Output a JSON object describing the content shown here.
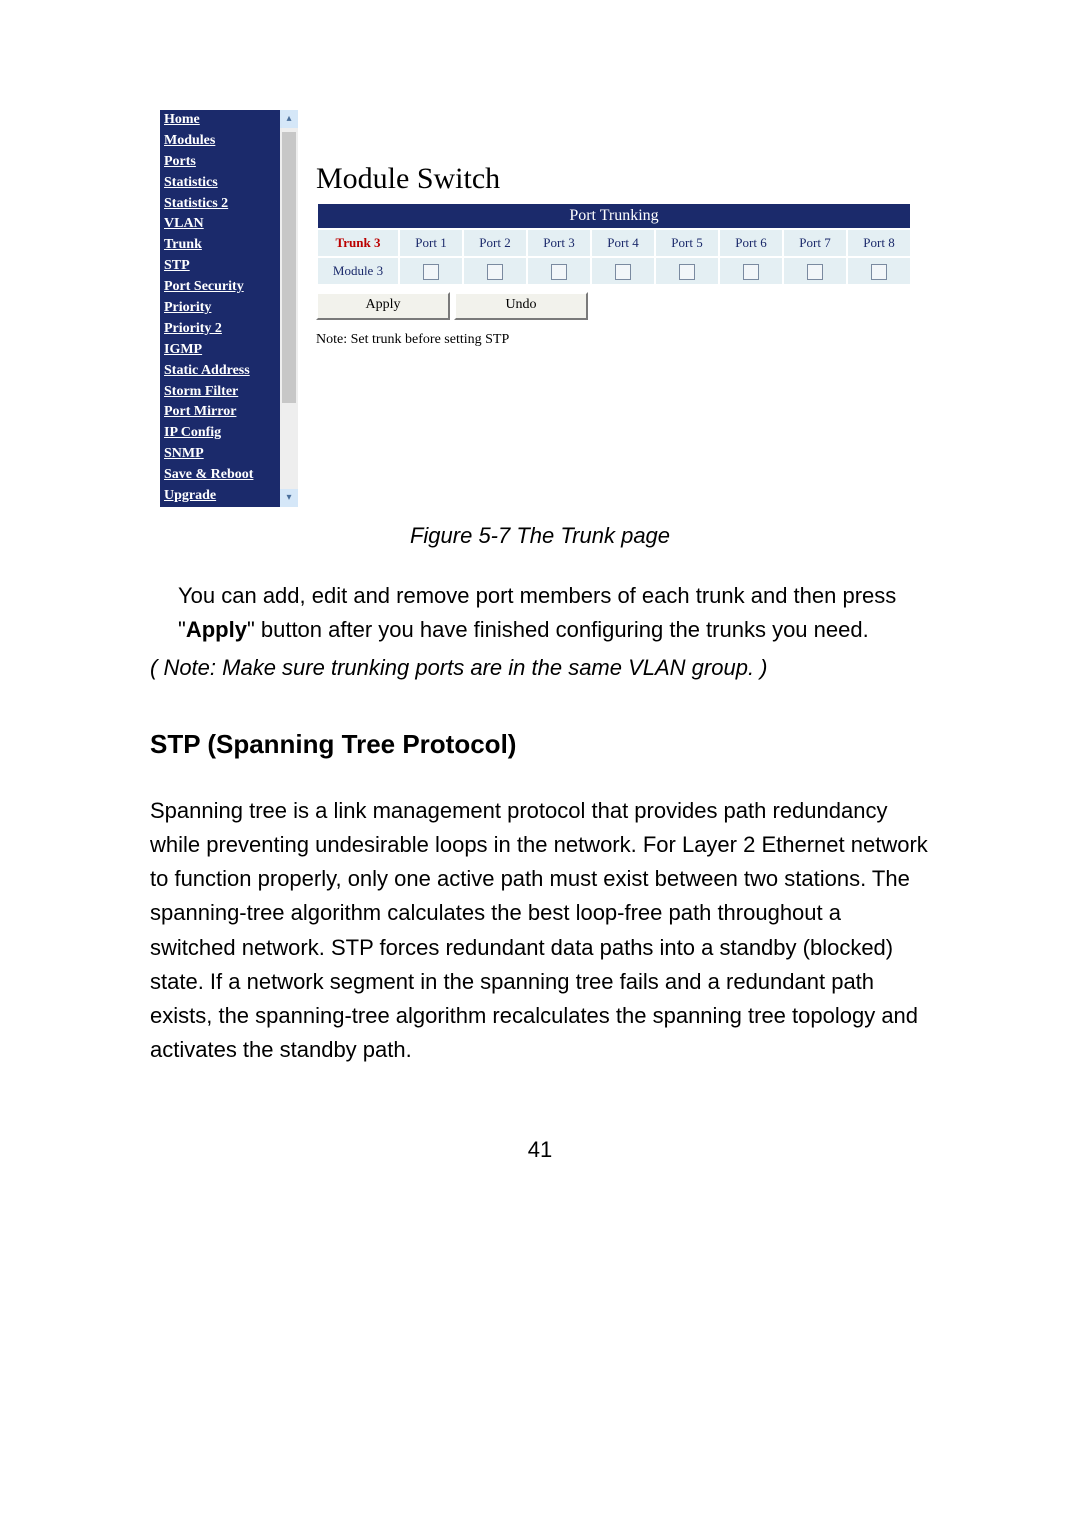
{
  "sidebar": {
    "items": [
      "Home",
      "Modules",
      "Ports",
      "Statistics",
      "Statistics 2",
      "VLAN",
      "Trunk",
      "STP",
      "Port Security",
      "Priority",
      "Priority 2",
      "IGMP",
      "Static Address",
      "Storm Filter",
      "Port Mirror",
      "IP Config",
      "SNMP",
      "Save & Reboot",
      "Upgrade"
    ]
  },
  "content": {
    "title": "Module Switch",
    "table_title": "Port  Trunking",
    "row1_head": "Trunk 3",
    "row2_head": "Module 3",
    "ports": [
      "Port 1",
      "Port 2",
      "Port 3",
      "Port 4",
      "Port 5",
      "Port 6",
      "Port 7",
      "Port 8"
    ],
    "btn_apply": "Apply",
    "btn_undo": "Undo",
    "note": "Note: Set trunk before setting STP"
  },
  "caption": "Figure 5-7 The Trunk page",
  "para1_pre": "You can add, edit and remove port members of each trunk and then press \"",
  "para1_bold": "Apply",
  "para1_post": "\" button after you have finished configuring the trunks you need.",
  "para2": "( Note: Make sure trunking ports are in the same VLAN group. )",
  "section_heading": "STP (Spanning Tree Protocol)",
  "para3": "Spanning tree is a link management protocol that provides path redundancy while preventing undesirable loops in the network. For Layer 2 Ethernet network to function properly, only one active path must exist between two stations. The spanning-tree algorithm calculates the best loop-free path throughout a switched network. STP forces redundant data paths into a standby (blocked) state. If a network segment in the spanning tree fails and a redundant path exists, the spanning-tree algorithm recalculates the spanning tree topology and activates the standby path.",
  "page_number": "41"
}
